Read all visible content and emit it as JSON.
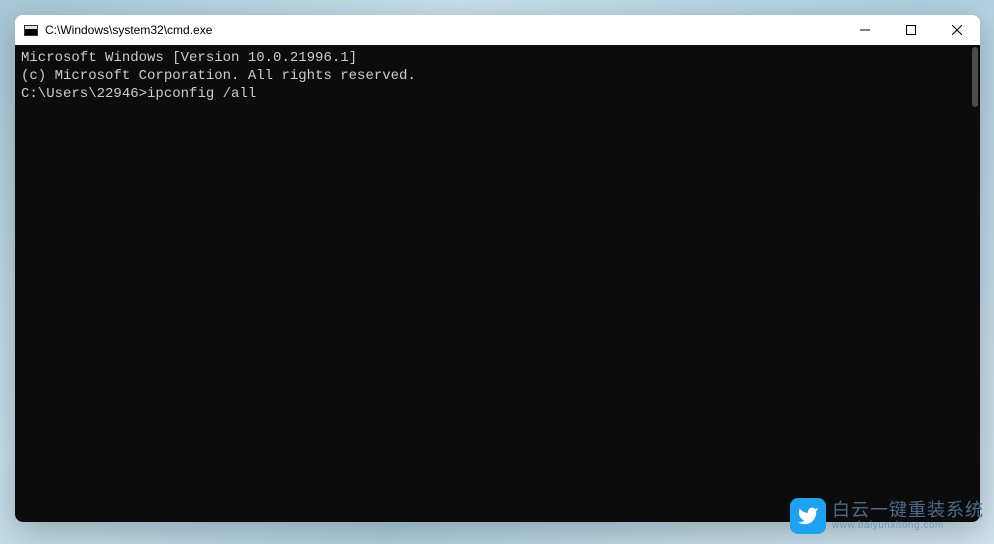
{
  "window": {
    "title": "C:\\Windows\\system32\\cmd.exe"
  },
  "terminal": {
    "line1": "Microsoft Windows [Version 10.0.21996.1]",
    "line2": "(c) Microsoft Corporation. All rights reserved.",
    "blank": "",
    "prompt": "C:\\Users\\22946>",
    "command": "ipconfig /all"
  },
  "watermark": {
    "main": "白云一键重装系统",
    "sub": "www.baiyunxitong.com"
  }
}
